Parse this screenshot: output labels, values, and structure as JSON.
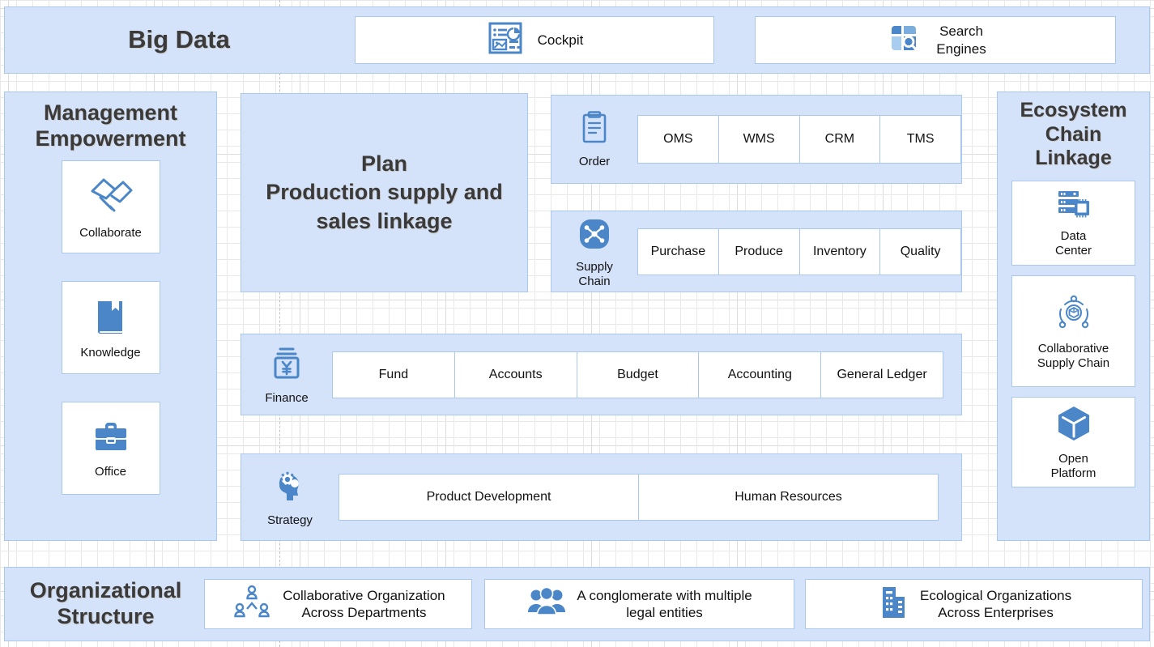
{
  "colors": {
    "panel_fill": "#d4e2fa",
    "panel_border": "#a9c8ef",
    "card_bg": "#ffffff",
    "icon_blue": "#4a86c8",
    "icon_blue_light": "#7badde",
    "title_text": "#3a3a3a",
    "body_text": "#111111",
    "grid_line": "#e8e8e8",
    "page_bg": "#ffffff"
  },
  "top_bar": {
    "title": "Big Data",
    "items": [
      {
        "label": "Cockpit",
        "icon": "dashboard-cockpit-icon"
      },
      {
        "label_line1": "Search",
        "label_line2": "Engines",
        "icon": "search-engine-icon"
      }
    ]
  },
  "left_panel": {
    "title_line1": "Management",
    "title_line2": "Empowerment",
    "items": [
      {
        "label": "Collaborate",
        "icon": "handshake-icon"
      },
      {
        "label": "Knowledge",
        "icon": "book-icon"
      },
      {
        "label": "Office",
        "icon": "briefcase-icon"
      }
    ]
  },
  "right_panel": {
    "title_line1": "Ecosystem",
    "title_line2": "Chain",
    "title_line3": "Linkage",
    "items": [
      {
        "label_line1": "Data",
        "label_line2": "Center",
        "icon": "server-chip-icon"
      },
      {
        "label_line1": "Collaborative",
        "label_line2": "Supply Chain",
        "icon": "supply-network-icon"
      },
      {
        "label_line1": "Open",
        "label_line2": "Platform",
        "icon": "cube-icon"
      }
    ]
  },
  "plan_block": {
    "title_line1": "Plan",
    "title_line2": "Production supply and",
    "title_line3": "sales linkage"
  },
  "rows": [
    {
      "id": "order",
      "icon": "clipboard-icon",
      "icon_label_line1": "Order",
      "icon_label_line2": "",
      "chips": [
        "OMS",
        "WMS",
        "CRM",
        "TMS"
      ]
    },
    {
      "id": "supply",
      "icon": "supply-chain-node-icon",
      "icon_label_line1": "Supply",
      "icon_label_line2": "Chain",
      "chips": [
        "Purchase",
        "Produce",
        "Inventory",
        "Quality"
      ]
    },
    {
      "id": "finance",
      "icon": "yen-currency-icon",
      "icon_label_line1": "Finance",
      "icon_label_line2": "",
      "chips": [
        "Fund",
        "Accounts",
        "Budget",
        "Accounting",
        "General Ledger"
      ]
    },
    {
      "id": "strategy",
      "icon": "head-gear-icon",
      "icon_label_line1": "Strategy",
      "icon_label_line2": "",
      "chips": [
        "Product Development",
        "Human Resources"
      ]
    }
  ],
  "bottom_panel": {
    "title_line1": "Organizational",
    "title_line2": "Structure",
    "items": [
      {
        "label_line1": "Collaborative Organization",
        "label_line2": "Across Departments",
        "icon": "org-hierarchy-icon"
      },
      {
        "label_line1": "A conglomerate with multiple",
        "label_line2": "legal entities",
        "icon": "people-group-icon"
      },
      {
        "label_line1": "Ecological Organizations",
        "label_line2": "Across Enterprises",
        "icon": "building-icon"
      }
    ]
  }
}
